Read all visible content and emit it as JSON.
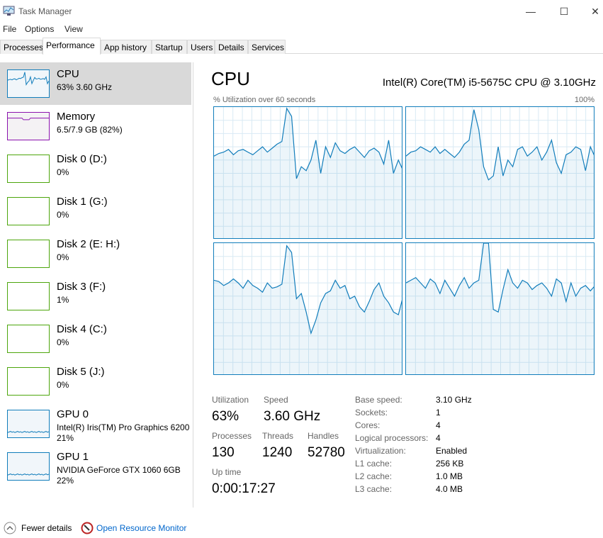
{
  "window": {
    "title": "Task Manager",
    "minimize": "—",
    "maximize": "☐",
    "close": "✕"
  },
  "menu": [
    "File",
    "Options",
    "View"
  ],
  "tabs": [
    {
      "label": "Processes"
    },
    {
      "label": "Performance",
      "active": true
    },
    {
      "label": "App history"
    },
    {
      "label": "Startup"
    },
    {
      "label": "Users"
    },
    {
      "label": "Details"
    },
    {
      "label": "Services"
    }
  ],
  "sidebar": [
    {
      "name": "CPU",
      "sub": "63%  3.60 GHz",
      "color": "#117dbb",
      "selected": true
    },
    {
      "name": "Memory",
      "sub": "6.5/7.9 GB (82%)",
      "color": "#8b12ae"
    },
    {
      "name": "Disk 0 (D:)",
      "sub": "0%",
      "color": "#4da60c"
    },
    {
      "name": "Disk 1 (G:)",
      "sub": "0%",
      "color": "#4da60c"
    },
    {
      "name": "Disk 2 (E: H:)",
      "sub": "0%",
      "color": "#4da60c"
    },
    {
      "name": "Disk 3 (F:)",
      "sub": "1%",
      "color": "#4da60c"
    },
    {
      "name": "Disk 4 (C:)",
      "sub": "0%",
      "color": "#4da60c"
    },
    {
      "name": "Disk 5 (J:)",
      "sub": "0%",
      "color": "#4da60c"
    },
    {
      "name": "GPU 0",
      "sub": "Intel(R) Iris(TM) Pro Graphics 6200",
      "sub2": "21%",
      "color": "#117dbb"
    },
    {
      "name": "GPU 1",
      "sub": "NVIDIA GeForce GTX 1060 6GB",
      "sub2": "22%",
      "color": "#117dbb"
    }
  ],
  "main": {
    "title": "CPU",
    "model": "Intel(R) Core(TM) i5-5675C CPU @ 3.10GHz",
    "graph_label": "% Utilization over 60 seconds",
    "graph_max": "100%",
    "cores": [
      [
        63,
        65,
        66,
        68,
        64,
        67,
        68,
        66,
        64,
        67,
        70,
        66,
        69,
        72,
        74,
        99,
        93,
        46,
        55,
        52,
        60,
        75,
        50,
        70,
        62,
        73,
        67,
        65,
        68,
        70,
        66,
        62,
        67,
        69,
        66,
        57,
        75,
        50,
        60,
        52
      ],
      [
        63,
        66,
        67,
        70,
        68,
        66,
        70,
        65,
        68,
        65,
        62,
        66,
        72,
        75,
        98,
        83,
        55,
        45,
        48,
        70,
        48,
        60,
        55,
        68,
        70,
        63,
        66,
        70,
        60,
        66,
        75,
        58,
        50,
        64,
        66,
        70,
        68,
        52,
        70,
        62
      ],
      [
        72,
        71,
        68,
        70,
        73,
        70,
        66,
        72,
        68,
        66,
        63,
        70,
        66,
        67,
        69,
        98,
        93,
        58,
        62,
        48,
        32,
        42,
        55,
        62,
        64,
        72,
        66,
        68,
        58,
        60,
        52,
        48,
        56,
        65,
        70,
        60,
        55,
        48,
        46,
        60
      ],
      [
        70,
        72,
        74,
        70,
        66,
        73,
        70,
        62,
        72,
        66,
        60,
        68,
        74,
        66,
        70,
        72,
        102,
        100,
        50,
        48,
        65,
        80,
        70,
        66,
        72,
        70,
        65,
        68,
        70,
        66,
        60,
        73,
        70,
        56,
        70,
        60,
        66,
        68,
        64,
        68
      ]
    ],
    "stats": {
      "utilization_label": "Utilization",
      "utilization": "63%",
      "speed_label": "Speed",
      "speed": "3.60 GHz",
      "processes_label": "Processes",
      "processes": "130",
      "threads_label": "Threads",
      "threads": "1240",
      "handles_label": "Handles",
      "handles": "52780",
      "uptime_label": "Up time",
      "uptime": "0:00:17:27"
    },
    "specs": [
      [
        "Base speed:",
        "3.10 GHz"
      ],
      [
        "Sockets:",
        "1"
      ],
      [
        "Cores:",
        "4"
      ],
      [
        "Logical processors:",
        "4"
      ],
      [
        "Virtualization:",
        "Enabled"
      ],
      [
        "L1 cache:",
        "256 KB"
      ],
      [
        "L2 cache:",
        "1.0 MB"
      ],
      [
        "L3 cache:",
        "4.0 MB"
      ]
    ]
  },
  "footer": {
    "fewer_details": "Fewer details",
    "resource_monitor": "Open Resource Monitor",
    "link_color": "#0066cc"
  }
}
